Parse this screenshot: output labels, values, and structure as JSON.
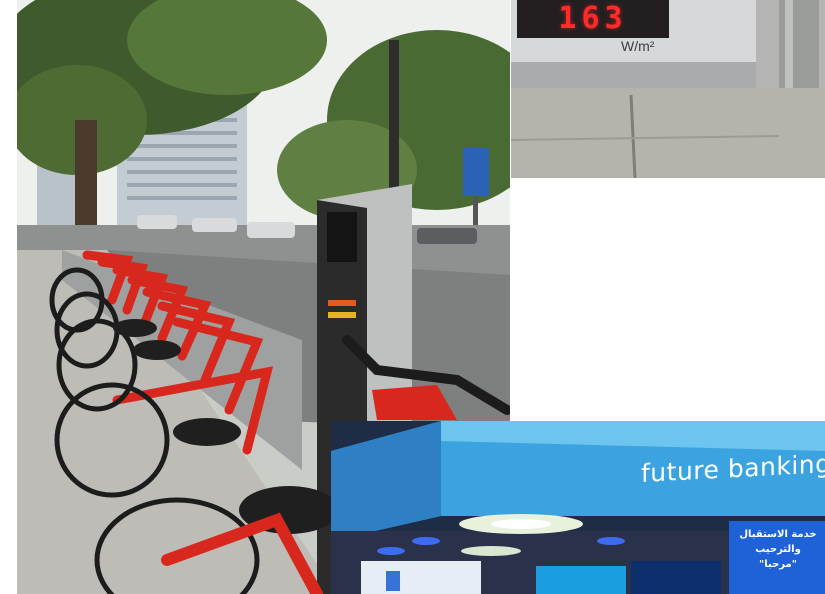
{
  "photos": {
    "meter": {
      "reading": "163",
      "unit": "W/m²",
      "colors": {
        "led": "#ff2a2a",
        "display": "#231f20"
      }
    },
    "bikes": {
      "colors": {
        "frame": "#d8281d",
        "sky": "#eef0ee",
        "road": "#8f9190"
      }
    },
    "bank": {
      "sign_text": "future banking",
      "arabic_line_1": "خدمة الاستقبال",
      "arabic_line_2": "والترحيب \"مرحبا\"",
      "colors": {
        "led_wall": "#3aa3e0",
        "ceiling": "#1f2c45"
      }
    }
  }
}
